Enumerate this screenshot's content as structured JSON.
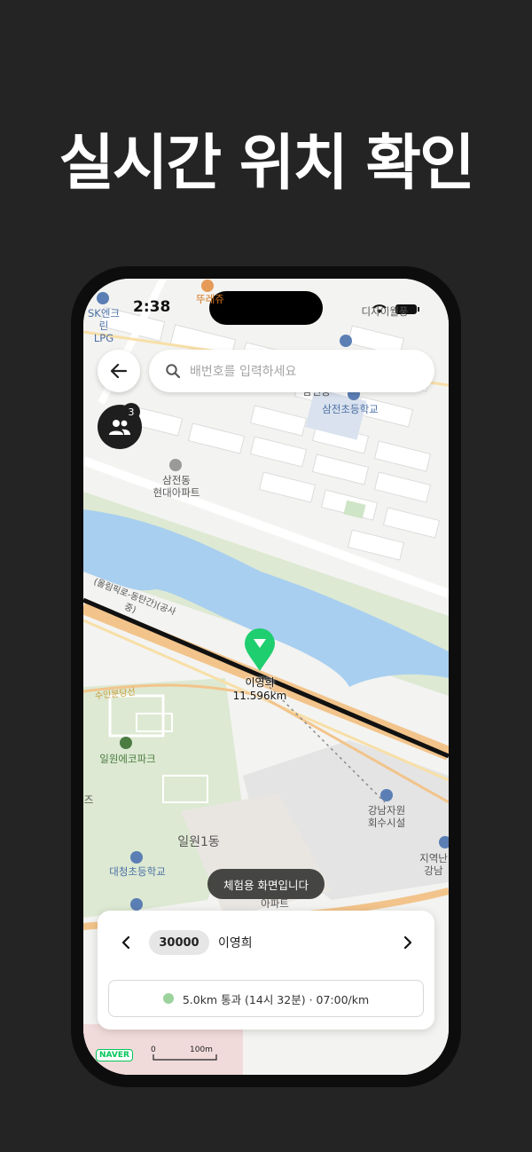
{
  "headline": "실시간 위치 확인",
  "status_bar": {
    "time": "2:38"
  },
  "search": {
    "placeholder": "배번호를 입력하세요"
  },
  "group": {
    "badge_count": "3"
  },
  "map_labels": {
    "sk_lpg": "SK엔크린\nLPG",
    "ddurejae": "뚜레쥬",
    "sign_partial": "디자이월풍",
    "samjeon_dong_partial": "삼전동",
    "samjeon_elementary": "삼전초등학교",
    "samjeon_apt": "삼전동\n현대아파트",
    "road_olympic": "(올림픽로-동탄간)(공사중)",
    "road_suinbundang": "수인분당선",
    "irwon_eco_park": "일원에코파크",
    "irwon1dong": "일원1동",
    "daecheong_elementary": "대청초등학교",
    "apartment_partial": "아파트",
    "gangnam_facility": "강남자원\n회수시설",
    "region_partial": "지역난\n강남",
    "edge_partial": "즈"
  },
  "runner": {
    "name": "이영희",
    "distance": "11.596km",
    "marker_color": "#1fce6f"
  },
  "toast": {
    "text": "체험용 화면입니다"
  },
  "panel": {
    "bib_number": "30000",
    "runner_name": "이영희",
    "progress_text": "5.0km 통과 (14시 32분) · 07:00/km",
    "progress_dot_color": "#9cd39c"
  },
  "footer": {
    "logo": "NAVER",
    "scale_zero": "0",
    "scale_label": "100m"
  },
  "colors": {
    "background": "#242424",
    "river": "#a8cff0",
    "park": "#dde9d2",
    "road_main": "#f2c48b",
    "route": "#111111"
  }
}
